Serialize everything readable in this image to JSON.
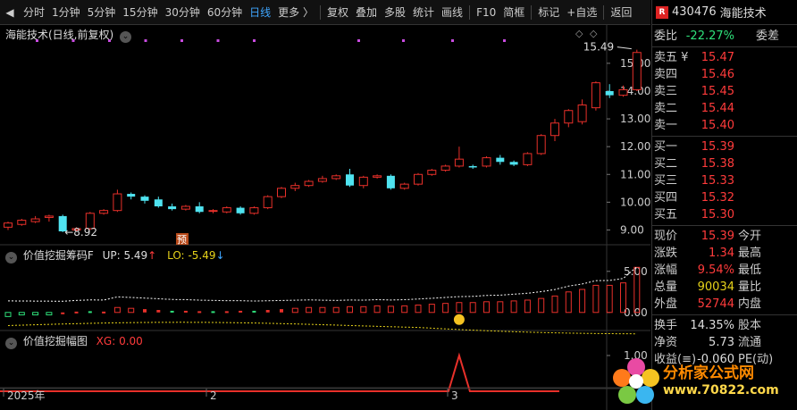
{
  "toolbar": {
    "icon": "back-icon",
    "items": [
      "分时",
      "1分钟",
      "5分钟",
      "15分钟",
      "30分钟",
      "60分钟",
      "日线",
      "更多 〉",
      "复权",
      "叠加",
      "多股",
      "统计",
      "画线",
      "F10",
      "简框",
      "标记",
      "+自选",
      "返回"
    ],
    "active_index": 6
  },
  "main_pane": {
    "title": "海能技术(日线,前复权)",
    "high_label": "15.49",
    "low_label": "8.92",
    "yticks": [
      "15.00",
      "14.00",
      "13.00",
      "12.00",
      "11.00",
      "10.00",
      "9.00"
    ],
    "marker_label": "预"
  },
  "indicator1": {
    "name": "价值挖掘筹码F",
    "up_label": "UP:",
    "up_value": "5.49",
    "lo_label": "LO:",
    "lo_value": "-5.49",
    "yticks": [
      "5.00",
      "0.00"
    ]
  },
  "indicator2": {
    "name": "价值挖掘幅图",
    "xg_label": "XG:",
    "xg_value": "0.00",
    "yticks": [
      "1.00"
    ]
  },
  "xaxis": {
    "labels": [
      "2025年",
      "2",
      "3"
    ]
  },
  "panel": {
    "code": "430476",
    "name": "海能技术",
    "weibi": {
      "label": "委比",
      "value": "-22.27%",
      "label2": "委差"
    },
    "sells": [
      {
        "label": "卖五 ¥",
        "price": "15.47"
      },
      {
        "label": "卖四",
        "price": "15.46"
      },
      {
        "label": "卖三",
        "price": "15.45"
      },
      {
        "label": "卖二",
        "price": "15.44"
      },
      {
        "label": "卖一",
        "price": "15.40"
      }
    ],
    "buys": [
      {
        "label": "买一",
        "price": "15.39"
      },
      {
        "label": "买二",
        "price": "15.38"
      },
      {
        "label": "买三",
        "price": "15.33"
      },
      {
        "label": "买四",
        "price": "15.32"
      },
      {
        "label": "买五",
        "price": "15.30"
      }
    ],
    "stats": [
      {
        "label": "现价",
        "value": "15.39",
        "label2": "今开",
        "color": "red"
      },
      {
        "label": "涨跌",
        "value": "1.34",
        "label2": "最高",
        "color": "red"
      },
      {
        "label": "涨幅",
        "value": "9.54%",
        "label2": "最低",
        "color": "red"
      },
      {
        "label": "总量",
        "value": "90034",
        "label2": "量比",
        "color": "yellow"
      },
      {
        "label": "外盘",
        "value": "52744",
        "label2": "内盘",
        "color": "red"
      }
    ],
    "stats2": [
      {
        "label": "换手",
        "value": "14.35%",
        "label2": "股本",
        "color": "white"
      },
      {
        "label": "净资",
        "value": "5.73",
        "label2": "流通",
        "color": "white"
      },
      {
        "label": "收益(≡)",
        "value": "-0.060",
        "label2": "PE(动)",
        "color": "white"
      }
    ]
  },
  "watermark": {
    "text": "分析家公式网",
    "url": "www.70822.com"
  },
  "colors": {
    "up": "#e8302a",
    "down": "#4fe3f0",
    "accent": "#3fa6ff",
    "magenta": "#c94be0"
  },
  "chart_data": {
    "type": "candlestick",
    "ylim": [
      8.5,
      15.8
    ],
    "candles": [
      [
        9.1,
        9.25,
        9.0,
        9.3
      ],
      [
        9.2,
        9.35,
        9.15,
        9.4
      ],
      [
        9.3,
        9.4,
        9.25,
        9.5
      ],
      [
        9.45,
        9.5,
        9.3,
        9.55
      ],
      [
        9.5,
        8.95,
        8.92,
        9.55
      ],
      [
        9.0,
        9.05,
        8.95,
        9.1
      ],
      [
        9.05,
        9.6,
        9.0,
        9.65
      ],
      [
        9.6,
        9.7,
        9.55,
        9.75
      ],
      [
        9.7,
        10.3,
        9.65,
        10.45
      ],
      [
        10.3,
        10.2,
        10.1,
        10.35
      ],
      [
        10.2,
        10.05,
        9.95,
        10.25
      ],
      [
        10.1,
        9.85,
        9.8,
        10.2
      ],
      [
        9.85,
        9.75,
        9.7,
        9.95
      ],
      [
        9.75,
        9.85,
        9.7,
        9.9
      ],
      [
        9.85,
        9.65,
        9.6,
        10.0
      ],
      [
        9.7,
        9.7,
        9.6,
        9.75
      ],
      [
        9.65,
        9.8,
        9.6,
        9.85
      ],
      [
        9.8,
        9.6,
        9.55,
        9.85
      ],
      [
        9.6,
        9.8,
        9.55,
        9.85
      ],
      [
        9.8,
        10.2,
        9.75,
        10.25
      ],
      [
        10.2,
        10.5,
        10.15,
        10.55
      ],
      [
        10.5,
        10.6,
        10.4,
        10.7
      ],
      [
        10.6,
        10.75,
        10.55,
        10.8
      ],
      [
        10.75,
        10.85,
        10.7,
        10.95
      ],
      [
        10.85,
        10.95,
        10.8,
        11.0
      ],
      [
        11.0,
        10.6,
        10.55,
        11.2
      ],
      [
        10.6,
        10.9,
        10.5,
        10.95
      ],
      [
        10.9,
        10.95,
        10.85,
        11.0
      ],
      [
        10.95,
        10.5,
        10.45,
        11.0
      ],
      [
        10.5,
        10.65,
        10.45,
        10.7
      ],
      [
        10.65,
        11.0,
        10.6,
        11.05
      ],
      [
        11.0,
        11.15,
        10.95,
        11.2
      ],
      [
        11.15,
        11.3,
        11.1,
        11.35
      ],
      [
        11.3,
        11.55,
        11.25,
        12.0
      ],
      [
        11.3,
        11.25,
        11.2,
        11.35
      ],
      [
        11.3,
        11.6,
        11.25,
        11.65
      ],
      [
        11.6,
        11.45,
        11.35,
        11.7
      ],
      [
        11.45,
        11.35,
        11.3,
        11.5
      ],
      [
        11.35,
        11.75,
        11.3,
        11.8
      ],
      [
        11.75,
        12.4,
        11.7,
        12.45
      ],
      [
        12.4,
        12.85,
        12.2,
        13.0
      ],
      [
        12.85,
        13.3,
        12.7,
        13.35
      ],
      [
        12.9,
        13.5,
        12.8,
        13.7
      ],
      [
        13.4,
        14.3,
        13.3,
        14.35
      ],
      [
        14.0,
        13.85,
        13.75,
        14.25
      ],
      [
        13.85,
        14.05,
        13.8,
        14.2
      ],
      [
        14.05,
        15.39,
        14.0,
        15.49
      ]
    ],
    "ind1_bars": [
      -0.5,
      -0.3,
      -0.3,
      -0.3,
      0.0,
      0.1,
      0.15,
      0.1,
      0.6,
      0.5,
      0.4,
      0.3,
      0.2,
      0.2,
      0.15,
      0.15,
      0.15,
      0.2,
      0.2,
      0.3,
      0.4,
      0.5,
      0.6,
      0.6,
      0.6,
      0.7,
      0.7,
      0.8,
      0.75,
      0.8,
      0.9,
      1.0,
      1.1,
      1.2,
      1.2,
      1.3,
      1.3,
      1.4,
      1.5,
      1.7,
      2.0,
      2.5,
      2.8,
      3.3,
      3.3,
      3.6,
      5.49
    ],
    "ind1_ylim": [
      -2.2,
      6.5
    ],
    "ind2_peak_index": 33,
    "ind2_ylim": [
      0,
      1.3
    ]
  }
}
